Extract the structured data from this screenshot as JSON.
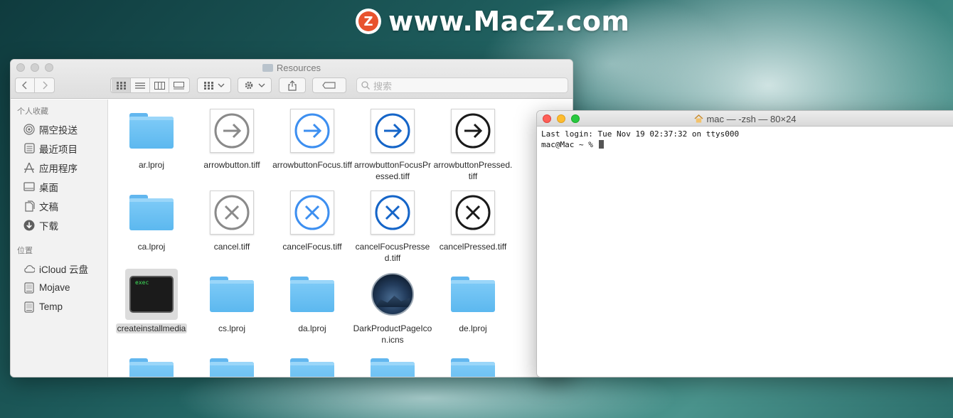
{
  "watermark": {
    "logo_letter": "Z",
    "text": "www.MacZ.com"
  },
  "finder": {
    "title": "Resources",
    "search_placeholder": "搜索",
    "sidebar": {
      "favorites_header": "个人收藏",
      "favorites": [
        {
          "label": "隔空投送",
          "icon": "airdrop-icon"
        },
        {
          "label": "最近项目",
          "icon": "recents-icon"
        },
        {
          "label": "应用程序",
          "icon": "applications-icon"
        },
        {
          "label": "桌面",
          "icon": "desktop-icon"
        },
        {
          "label": "文稿",
          "icon": "documents-icon"
        },
        {
          "label": "下载",
          "icon": "downloads-icon"
        }
      ],
      "locations_header": "位置",
      "locations": [
        {
          "label": "iCloud 云盘",
          "icon": "icloud-icon"
        },
        {
          "label": "Mojave",
          "icon": "disk-icon"
        },
        {
          "label": "Temp",
          "icon": "disk-icon"
        }
      ]
    },
    "files": [
      {
        "name": "ar.lproj",
        "kind": "folder"
      },
      {
        "name": "arrowbutton.tiff",
        "kind": "arrow",
        "color": "#8a8a8a"
      },
      {
        "name": "arrowbuttonFocus.tiff",
        "kind": "arrow",
        "color": "#3d8ff0"
      },
      {
        "name": "arrowbuttonFocusPressed.tiff",
        "kind": "arrow",
        "color": "#1565c8"
      },
      {
        "name": "arrowbuttonPressed.tiff",
        "kind": "arrow",
        "color": "#1a1a1a"
      },
      {
        "name": "ca.lproj",
        "kind": "folder"
      },
      {
        "name": "cancel.tiff",
        "kind": "cancel",
        "color": "#8a8a8a"
      },
      {
        "name": "cancelFocus.tiff",
        "kind": "cancel",
        "color": "#3d8ff0"
      },
      {
        "name": "cancelFocusPressed.tiff",
        "kind": "cancel",
        "color": "#1565c8"
      },
      {
        "name": "cancelPressed.tiff",
        "kind": "cancel",
        "color": "#1a1a1a"
      },
      {
        "name": "createinstallmedia",
        "kind": "exec",
        "selected": true,
        "exec_text": "exec"
      },
      {
        "name": "cs.lproj",
        "kind": "folder"
      },
      {
        "name": "da.lproj",
        "kind": "folder"
      },
      {
        "name": "DarkProductPageIcon.icns",
        "kind": "icns"
      },
      {
        "name": "de.lproj",
        "kind": "folder"
      },
      {
        "name": "",
        "kind": "folder"
      },
      {
        "name": "",
        "kind": "folder"
      },
      {
        "name": "",
        "kind": "folder"
      },
      {
        "name": "",
        "kind": "folder"
      },
      {
        "name": "",
        "kind": "folder"
      }
    ]
  },
  "terminal": {
    "title": "mac — -zsh — 80×24",
    "lines": [
      "Last login: Tue Nov 19 02:37:32 on ttys000",
      "mac@Mac ~ % "
    ]
  }
}
